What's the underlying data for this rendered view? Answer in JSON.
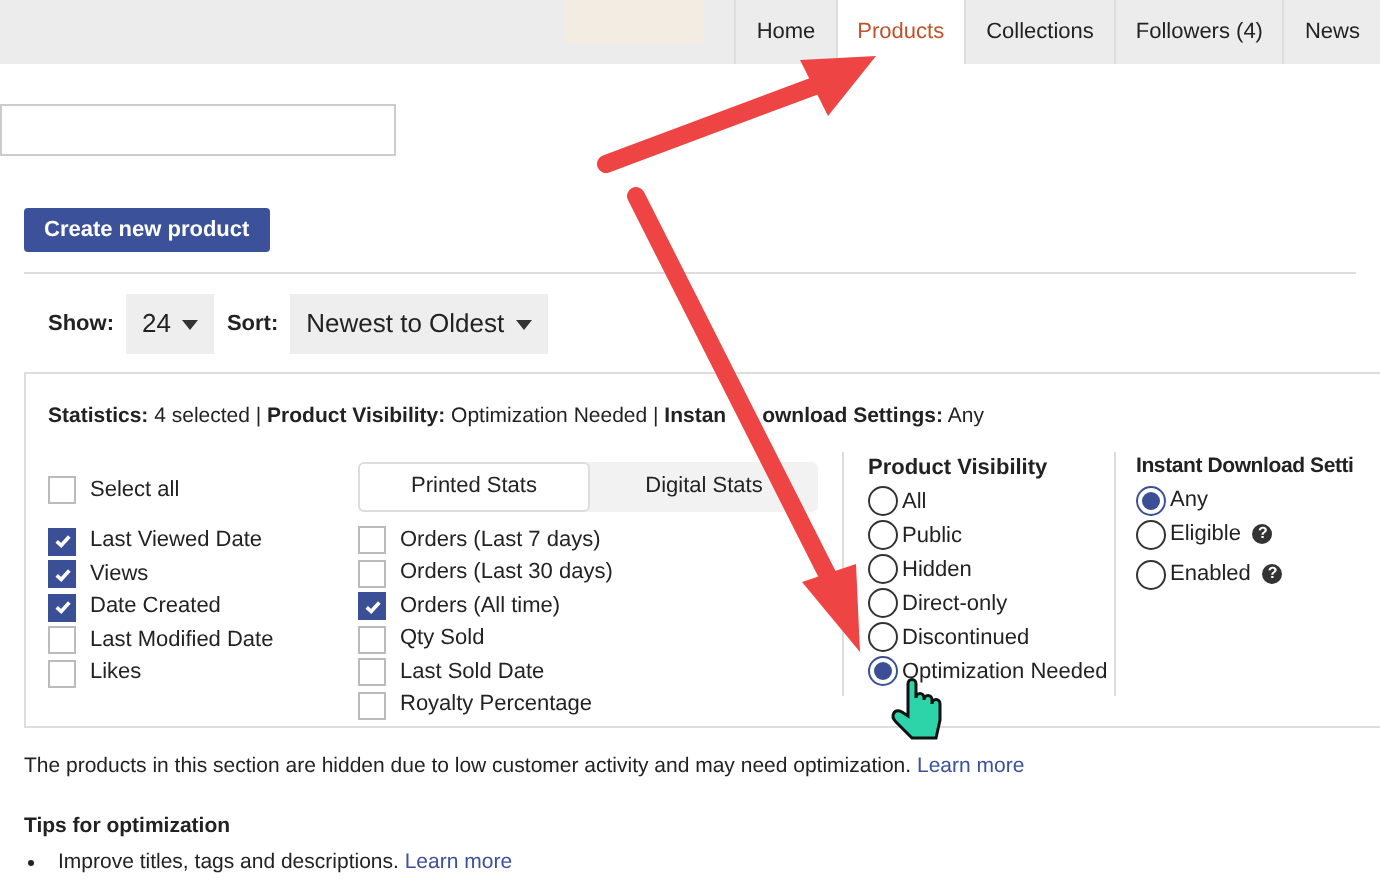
{
  "nav": {
    "tabs": [
      {
        "label": "Home",
        "selected": false
      },
      {
        "label": "Products",
        "selected": true
      },
      {
        "label": "Collections",
        "selected": false
      },
      {
        "label": "Followers (4)",
        "selected": false
      },
      {
        "label": "News",
        "selected": false
      }
    ]
  },
  "create_button": "Create new product",
  "show": {
    "label": "Show:",
    "value": "24"
  },
  "sort": {
    "label": "Sort:",
    "value": "Newest to Oldest"
  },
  "filters": {
    "summary": [
      "**Statistics:** 4 selected | **Product Visibility:** Optimization Needed | **Instan**",
      "**ownload Settings:** Any"
    ],
    "select_all": {
      "label": "Select all",
      "checked": false
    },
    "general_stats": [
      {
        "label": "Last Viewed Date",
        "checked": true
      },
      {
        "label": "Views",
        "checked": true
      },
      {
        "label": "Date Created",
        "checked": true
      },
      {
        "label": "Last Modified Date",
        "checked": false
      },
      {
        "label": "Likes",
        "checked": false
      }
    ],
    "stat_tabs": [
      {
        "label": "Printed Stats",
        "selected": true
      },
      {
        "label": "Digital Stats",
        "selected": false
      }
    ],
    "printed_stats": [
      {
        "label": "Orders (Last 7 days)",
        "checked": false
      },
      {
        "label": "Orders (Last 30 days)",
        "checked": false
      },
      {
        "label": "Orders (All time)",
        "checked": true
      },
      {
        "label": "Qty Sold",
        "checked": false
      },
      {
        "label": "Last Sold Date",
        "checked": false
      },
      {
        "label": "Royalty Percentage",
        "checked": false
      }
    ],
    "visibility": {
      "title": "Product Visibility",
      "options": [
        {
          "label": "All",
          "selected": false
        },
        {
          "label": "Public",
          "selected": false
        },
        {
          "label": "Hidden",
          "selected": false
        },
        {
          "label": "Direct-only",
          "selected": false
        },
        {
          "label": "Discontinued",
          "selected": false
        },
        {
          "label": "Optimization Needed",
          "selected": true
        }
      ]
    },
    "instant_download": {
      "title": "Instant Download Setti",
      "options": [
        {
          "label": "Any",
          "selected": true
        },
        {
          "label": "Eligible",
          "selected": false,
          "help": "?"
        },
        {
          "label": "Enabled",
          "selected": false,
          "help": "?"
        }
      ]
    }
  },
  "notice": {
    "text": "The products in this section are hidden due to low customer activity and may need optimization.",
    "link": "Learn more"
  },
  "tips": {
    "title": "Tips for optimization",
    "items": [
      {
        "text": "Improve titles, tags and descriptions.",
        "link": "Learn more"
      }
    ]
  }
}
